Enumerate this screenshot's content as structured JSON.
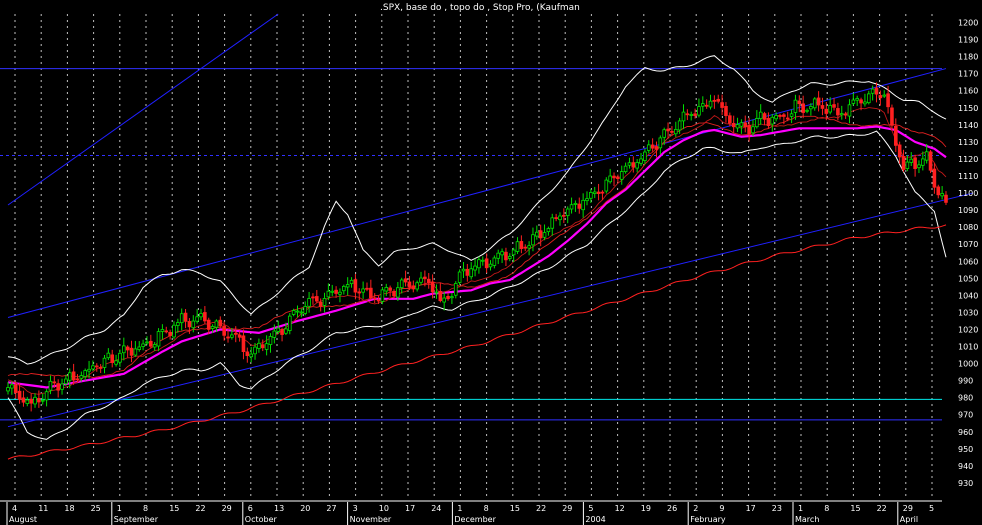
{
  "chart_data": {
    "type": "candlestick",
    "title": ".SPX, base do , topo do , Stop Pro, (Kaufman",
    "ylim": [
      920,
      1205
    ],
    "y_ticks": [
      930,
      940,
      950,
      960,
      970,
      980,
      990,
      1000,
      1010,
      1020,
      1030,
      1040,
      1050,
      1060,
      1070,
      1080,
      1090,
      1100,
      1110,
      1120,
      1130,
      1140,
      1150,
      1160,
      1170,
      1180,
      1190,
      1200
    ],
    "grid": "dotted vertical",
    "day_labels": [
      "4",
      "11",
      "18",
      "25",
      "1",
      "8",
      "15",
      "22",
      "29",
      "6",
      "13",
      "20",
      "27",
      "3",
      "10",
      "17",
      "24",
      "1",
      "8",
      "15",
      "22",
      "29",
      "5",
      "12",
      "19",
      "26",
      "2",
      "9",
      "17",
      "23",
      "1",
      "8",
      "15",
      "22",
      "29",
      "5"
    ],
    "month_labels": [
      "August",
      "September",
      "October",
      "November",
      "December",
      "2004",
      "February",
      "March",
      "April"
    ],
    "day_label_months": [
      0,
      4,
      9,
      13,
      17,
      22,
      26,
      30,
      34
    ],
    "price": {
      "anchors": [
        [
          0,
          986
        ],
        [
          3,
          982
        ],
        [
          6,
          976
        ],
        [
          9,
          981
        ],
        [
          12,
          988
        ],
        [
          18,
          993
        ],
        [
          25,
          1001
        ],
        [
          30,
          1007
        ],
        [
          35,
          1010
        ],
        [
          40,
          1018
        ],
        [
          45,
          1025
        ],
        [
          50,
          1026
        ],
        [
          55,
          1022
        ],
        [
          60,
          1012
        ],
        [
          63,
          1005
        ],
        [
          67,
          1014
        ],
        [
          72,
          1023
        ],
        [
          78,
          1035
        ],
        [
          85,
          1043
        ],
        [
          90,
          1046
        ],
        [
          95,
          1038
        ],
        [
          100,
          1044
        ],
        [
          105,
          1048
        ],
        [
          110,
          1046
        ],
        [
          112,
          1036
        ],
        [
          115,
          1044
        ],
        [
          120,
          1058
        ],
        [
          125,
          1061
        ],
        [
          130,
          1066
        ],
        [
          135,
          1072
        ],
        [
          140,
          1080
        ],
        [
          145,
          1090
        ],
        [
          150,
          1098
        ],
        [
          155,
          1106
        ],
        [
          160,
          1114
        ],
        [
          165,
          1122
        ],
        [
          170,
          1133
        ],
        [
          175,
          1143
        ],
        [
          180,
          1150
        ],
        [
          183,
          1156
        ],
        [
          186,
          1144
        ],
        [
          190,
          1137
        ],
        [
          195,
          1143
        ],
        [
          200,
          1145
        ],
        [
          205,
          1151
        ],
        [
          210,
          1152
        ],
        [
          215,
          1146
        ],
        [
          220,
          1154
        ],
        [
          225,
          1160
        ],
        [
          227,
          1158
        ],
        [
          229,
          1140
        ],
        [
          232,
          1114
        ],
        [
          235,
          1118
        ],
        [
          238,
          1122
        ],
        [
          241,
          1100
        ],
        [
          243,
          1094
        ]
      ],
      "wiggle": 4.5
    },
    "series": [
      {
        "name": "",
        "color": "#ff00ff",
        "role": "kaufman-ma",
        "points": [
          [
            0,
            989
          ],
          [
            10,
            986
          ],
          [
            20,
            990
          ],
          [
            30,
            994
          ],
          [
            40,
            1007
          ],
          [
            45,
            1013
          ],
          [
            55,
            1020
          ],
          [
            65,
            1018
          ],
          [
            75,
            1025
          ],
          [
            85,
            1031
          ],
          [
            95,
            1038
          ],
          [
            105,
            1038
          ],
          [
            110,
            1041
          ],
          [
            115,
            1042
          ],
          [
            120,
            1043
          ],
          [
            125,
            1047
          ],
          [
            130,
            1049
          ],
          [
            135,
            1056
          ],
          [
            140,
            1063
          ],
          [
            145,
            1072
          ],
          [
            150,
            1082
          ],
          [
            155,
            1094
          ],
          [
            160,
            1102
          ],
          [
            165,
            1113
          ],
          [
            170,
            1124
          ],
          [
            175,
            1131
          ],
          [
            180,
            1136
          ],
          [
            183,
            1137
          ],
          [
            190,
            1133
          ],
          [
            195,
            1134
          ],
          [
            200,
            1136
          ],
          [
            205,
            1138
          ],
          [
            210,
            1138
          ],
          [
            215,
            1138
          ],
          [
            220,
            1138
          ],
          [
            225,
            1139
          ],
          [
            230,
            1137
          ],
          [
            235,
            1130
          ],
          [
            240,
            1126
          ],
          [
            243,
            1121
          ]
        ]
      },
      {
        "name": "",
        "color": "#ffffff",
        "role": "upper-band",
        "points": [
          [
            0,
            1004
          ],
          [
            5,
            1000
          ],
          [
            10,
            1004
          ],
          [
            15,
            1009
          ],
          [
            20,
            1015
          ],
          [
            25,
            1020
          ],
          [
            30,
            1028
          ],
          [
            35,
            1045
          ],
          [
            40,
            1052
          ],
          [
            45,
            1055
          ],
          [
            50,
            1053
          ],
          [
            55,
            1048
          ],
          [
            60,
            1036
          ],
          [
            63,
            1029
          ],
          [
            67,
            1036
          ],
          [
            72,
            1046
          ],
          [
            78,
            1057
          ],
          [
            82,
            1080
          ],
          [
            85,
            1095
          ],
          [
            88,
            1088
          ],
          [
            92,
            1066
          ],
          [
            96,
            1058
          ],
          [
            100,
            1065
          ],
          [
            105,
            1068
          ],
          [
            110,
            1070
          ],
          [
            115,
            1066
          ],
          [
            120,
            1060
          ],
          [
            125,
            1068
          ],
          [
            130,
            1076
          ],
          [
            135,
            1088
          ],
          [
            140,
            1100
          ],
          [
            145,
            1112
          ],
          [
            150,
            1128
          ],
          [
            155,
            1144
          ],
          [
            160,
            1163
          ],
          [
            165,
            1173
          ],
          [
            170,
            1172
          ],
          [
            175,
            1174
          ],
          [
            180,
            1178
          ],
          [
            183,
            1180
          ],
          [
            188,
            1173
          ],
          [
            193,
            1160
          ],
          [
            198,
            1153
          ],
          [
            203,
            1160
          ],
          [
            208,
            1164
          ],
          [
            213,
            1164
          ],
          [
            218,
            1165
          ],
          [
            223,
            1166
          ],
          [
            228,
            1160
          ],
          [
            232,
            1155
          ],
          [
            236,
            1153
          ],
          [
            240,
            1148
          ],
          [
            243,
            1143
          ]
        ]
      },
      {
        "name": "",
        "color": "#ffffff",
        "role": "lower-band",
        "points": [
          [
            0,
            980
          ],
          [
            5,
            960
          ],
          [
            10,
            955
          ],
          [
            15,
            962
          ],
          [
            20,
            970
          ],
          [
            25,
            975
          ],
          [
            30,
            980
          ],
          [
            35,
            988
          ],
          [
            40,
            992
          ],
          [
            45,
            996
          ],
          [
            50,
            996
          ],
          [
            55,
            1000
          ],
          [
            60,
            988
          ],
          [
            63,
            985
          ],
          [
            67,
            992
          ],
          [
            72,
            1000
          ],
          [
            78,
            1008
          ],
          [
            85,
            1018
          ],
          [
            90,
            1020
          ],
          [
            95,
            1022
          ],
          [
            100,
            1024
          ],
          [
            105,
            1030
          ],
          [
            110,
            1033
          ],
          [
            115,
            1032
          ],
          [
            120,
            1036
          ],
          [
            125,
            1040
          ],
          [
            130,
            1045
          ],
          [
            135,
            1050
          ],
          [
            140,
            1056
          ],
          [
            145,
            1063
          ],
          [
            150,
            1070
          ],
          [
            155,
            1080
          ],
          [
            160,
            1090
          ],
          [
            165,
            1100
          ],
          [
            170,
            1113
          ],
          [
            175,
            1120
          ],
          [
            180,
            1126
          ],
          [
            183,
            1126
          ],
          [
            190,
            1123
          ],
          [
            195,
            1127
          ],
          [
            200,
            1128
          ],
          [
            205,
            1131
          ],
          [
            210,
            1133
          ],
          [
            215,
            1133
          ],
          [
            220,
            1134
          ],
          [
            225,
            1136
          ],
          [
            230,
            1122
          ],
          [
            235,
            1100
          ],
          [
            240,
            1090
          ],
          [
            243,
            1062
          ]
        ]
      },
      {
        "name": "",
        "color": "#ff2020",
        "role": "long-ma",
        "points": [
          [
            0,
            944
          ],
          [
            20,
            952
          ],
          [
            40,
            961
          ],
          [
            60,
            972
          ],
          [
            80,
            985
          ],
          [
            100,
            998
          ],
          [
            120,
            1010
          ],
          [
            140,
            1024
          ],
          [
            160,
            1038
          ],
          [
            180,
            1052
          ],
          [
            200,
            1064
          ],
          [
            220,
            1074
          ],
          [
            235,
            1079
          ],
          [
            243,
            1081
          ]
        ]
      }
    ],
    "trendlines": [
      {
        "color": "#2020ff",
        "from": [
          0,
          1027
        ],
        "to": [
          243,
          1173
        ]
      },
      {
        "color": "#2020ff",
        "from": [
          0,
          963
        ],
        "to": [
          250,
          1100
        ]
      },
      {
        "color": "#2020ff",
        "from": [
          0,
          1093
        ],
        "to": [
          70,
          1205
        ]
      }
    ],
    "hlines": [
      {
        "value": 1173,
        "color": "#3030ff",
        "style": "solid"
      },
      {
        "value": 1122,
        "color": "#3030ff",
        "style": "dashed"
      },
      {
        "value": 979,
        "color": "#00e8e8",
        "style": "solid"
      },
      {
        "value": 967,
        "color": "#3030ff",
        "style": "solid"
      }
    ],
    "colors": {
      "up": "#00e000",
      "down": "#ff2020",
      "grid": "#ffffff",
      "text": "#ffffff",
      "background": "#000000"
    }
  }
}
